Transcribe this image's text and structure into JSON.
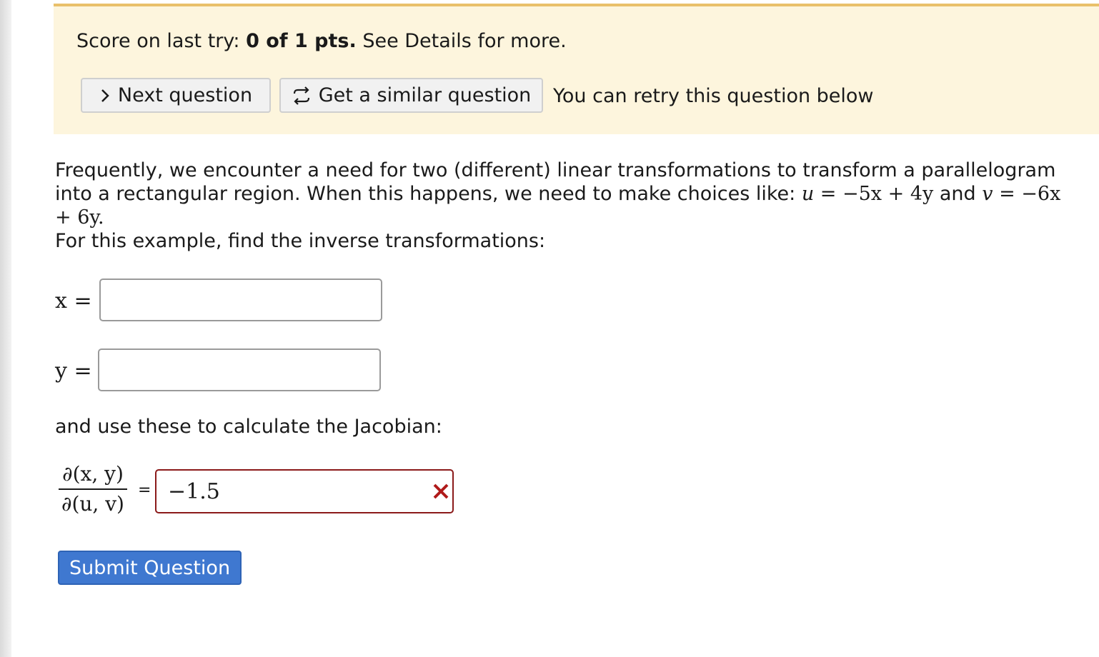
{
  "banner": {
    "score_prefix": "Score on last try: ",
    "score_value": "0 of 1 pts.",
    "score_suffix": " See Details for more.",
    "next_button_label": "Next question",
    "similar_button_label": "Get a similar question",
    "retry_text": "You can retry this question below"
  },
  "question": {
    "text_line1": "Frequently, we encounter a need for two (different) linear transformations to transform a parallelogram into a rectangular region. When this happens, we need to make choices like: ",
    "u_var": "u",
    "u_expr": " = −5x + 4y",
    "and_text": " and ",
    "v_var": "v",
    "v_expr": " = −6x + 6y.",
    "instruction1": "For this example, find the inverse transformations:",
    "x_label": "x =",
    "y_label": "y =",
    "x_value": "",
    "y_value": "",
    "instruction2": "and use these to calculate the Jacobian:",
    "jacobian_numerator": "∂(x, y)",
    "jacobian_denominator": "∂(u, v)",
    "equals": "=",
    "jacobian_value": "−1.5",
    "jacobian_status": "incorrect"
  },
  "submit_label": "Submit Question",
  "colors": {
    "banner_bg": "#fdf5dd",
    "banner_border": "#e9c06a",
    "error_red": "#8b1a1a",
    "submit_blue": "#3f78d0"
  }
}
